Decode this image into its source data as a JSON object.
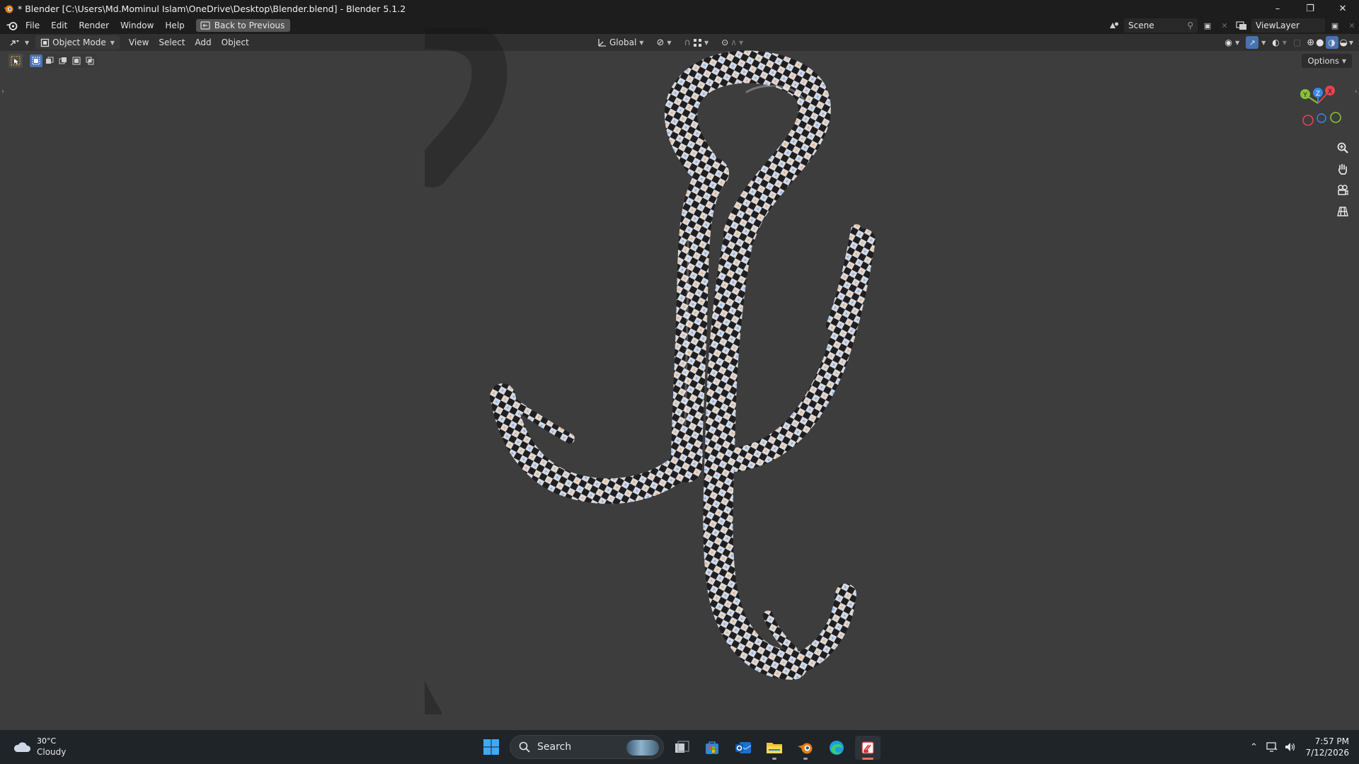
{
  "window": {
    "title": "* Blender [C:\\Users\\Md.Mominul Islam\\OneDrive\\Desktop\\Blender.blend] - Blender 5.1.2",
    "controls": {
      "minimize": "–",
      "restore": "❐",
      "close": "✕"
    }
  },
  "menubar": {
    "items": [
      "File",
      "Edit",
      "Render",
      "Window",
      "Help"
    ],
    "back_button": "Back to Previous",
    "scene_label": "Scene",
    "viewlayer_label": "ViewLayer"
  },
  "viewport_header": {
    "mode": "Object Mode",
    "menus": [
      "View",
      "Select",
      "Add",
      "Object"
    ],
    "transform_orientation": "Global",
    "options": "Options"
  },
  "gizmo": {
    "x": "X",
    "y": "Y",
    "z": "Z"
  },
  "colors": {
    "viewport_bg": "#3d3d3d",
    "header_bg": "#303030",
    "topbar_bg": "#1d1d1d",
    "axis_x": "#e6434f",
    "axis_y": "#8ac236",
    "axis_z": "#3b87e8",
    "accent": "#4772b3"
  },
  "icons": [
    "blender-logo-icon",
    "editor-type-icon",
    "cursor-select-icon",
    "zoom-icon",
    "hand-pan-icon",
    "camera-icon",
    "grid-ortho-icon",
    "search-icon",
    "windows-start-icon",
    "weather-cloud-icon"
  ],
  "taskbar": {
    "weather_temp": "30°C",
    "weather_cond": "Cloudy",
    "search_label": "Search",
    "time": "7:57 PM",
    "date": "7/12/2026"
  }
}
